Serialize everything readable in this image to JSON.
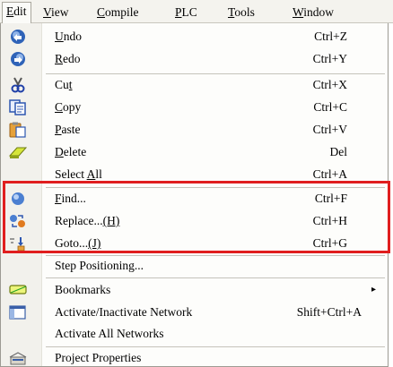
{
  "menubar": {
    "items": [
      {
        "label": "Edit",
        "mnemonic": "E",
        "rest": "dit",
        "active": true
      },
      {
        "label": "View",
        "mnemonic": "V",
        "rest": "iew"
      },
      {
        "label": "Compile",
        "mnemonic": "C",
        "rest": "ompile"
      },
      {
        "label": "PLC",
        "mnemonic": "P",
        "rest": "LC"
      },
      {
        "label": "Tools",
        "mnemonic": "T",
        "rest": "ools"
      },
      {
        "label": "Window",
        "mnemonic": "W",
        "rest": "indow"
      }
    ]
  },
  "edit_menu": {
    "items": [
      {
        "pre": "",
        "mn": "U",
        "post": "ndo",
        "shortcut": "Ctrl+Z",
        "icon": "undo-icon"
      },
      {
        "pre": "",
        "mn": "R",
        "post": "edo",
        "shortcut": "Ctrl+Y",
        "icon": "redo-icon"
      },
      {
        "pre": "Cu",
        "mn": "t",
        "post": "",
        "shortcut": "Ctrl+X",
        "icon": "scissors-icon"
      },
      {
        "pre": "",
        "mn": "C",
        "post": "opy",
        "shortcut": "Ctrl+C",
        "icon": "copy-icon"
      },
      {
        "pre": "",
        "mn": "P",
        "post": "aste",
        "shortcut": "Ctrl+V",
        "icon": "paste-icon"
      },
      {
        "pre": "",
        "mn": "D",
        "post": "elete",
        "shortcut": "Del",
        "icon": "eraser-icon"
      },
      {
        "pre": "Select ",
        "mn": "A",
        "post": "ll",
        "shortcut": "Ctrl+A",
        "icon": ""
      },
      {
        "pre": "",
        "mn": "F",
        "post": "ind...",
        "shortcut": "Ctrl+F",
        "icon": "find-icon"
      },
      {
        "pre": "Replace...",
        "mn": "(H)",
        "post": "",
        "shortcut": "Ctrl+H",
        "icon": "replace-icon"
      },
      {
        "pre": "Goto...",
        "mn": "(J)",
        "post": "",
        "shortcut": "Ctrl+G",
        "icon": "goto-icon"
      },
      {
        "pre": "Step Positioning...",
        "mn": "",
        "post": "",
        "shortcut": "",
        "icon": ""
      },
      {
        "pre": "Bookmarks",
        "mn": "",
        "post": "",
        "shortcut": "",
        "icon": "bookmark-icon",
        "submenu": "▸"
      },
      {
        "pre": "Activate/Inactivate Network",
        "mn": "",
        "post": "",
        "shortcut": "Shift+Ctrl+A",
        "icon": "network-icon"
      },
      {
        "pre": "Activate All Networks",
        "mn": "",
        "post": "",
        "shortcut": "",
        "icon": ""
      },
      {
        "pre": "Project Properties",
        "mn": "",
        "post": "",
        "shortcut": "",
        "icon": "properties-icon"
      }
    ]
  },
  "colors": {
    "highlight_border": "#e01e1e",
    "menu_background": "#fdfdfb",
    "menubar_background": "#f4f3ee"
  }
}
